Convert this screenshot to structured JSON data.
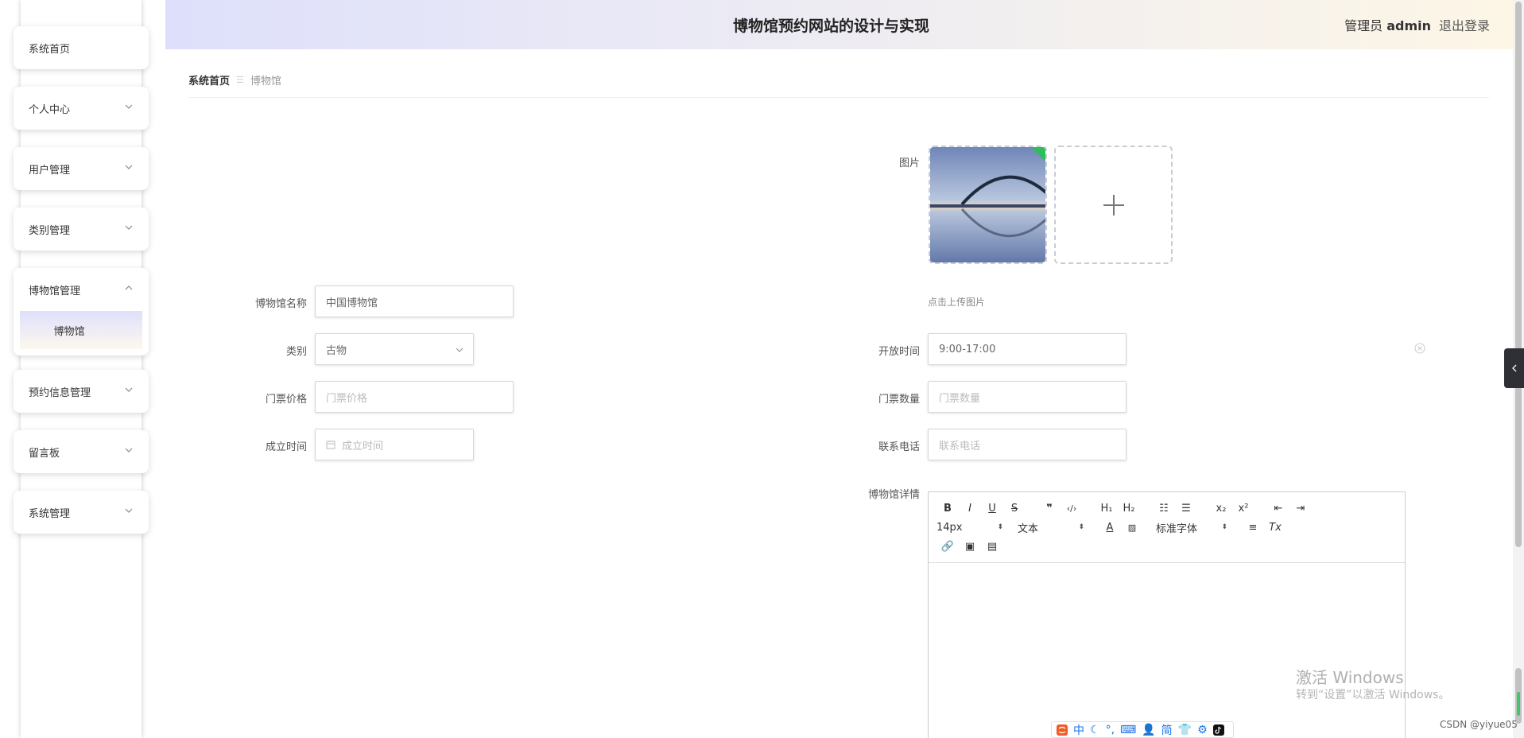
{
  "app": {
    "title": "博物馆预约网站的设计与实现",
    "user_role": "管理员",
    "user_name": "admin",
    "logout": "退出登录"
  },
  "sidebar": {
    "items": [
      {
        "label": "系统首页"
      },
      {
        "label": "个人中心"
      },
      {
        "label": "用户管理"
      },
      {
        "label": "类别管理"
      },
      {
        "label": "博物馆管理",
        "expanded": true,
        "children": [
          {
            "label": "博物馆"
          }
        ]
      },
      {
        "label": "预约信息管理"
      },
      {
        "label": "留言板"
      },
      {
        "label": "系统管理"
      }
    ]
  },
  "breadcrumb": {
    "home": "系统首页",
    "separator": "☰",
    "current": "博物馆"
  },
  "form": {
    "image_label": "图片",
    "upload_hint": "点击上传图片",
    "name_label": "博物馆名称",
    "name_value": "中国博物馆",
    "category_label": "类别",
    "category_value": "古物",
    "open_time_label": "开放时间",
    "open_time_value": "9:00-17:00",
    "price_label": "门票价格",
    "price_placeholder": "门票价格",
    "ticket_count_label": "门票数量",
    "ticket_count_placeholder": "门票数量",
    "founded_label": "成立时间",
    "founded_placeholder": "成立时间",
    "phone_label": "联系电话",
    "phone_placeholder": "联系电话",
    "details_label": "博物馆详情"
  },
  "editor": {
    "font_size": "14px",
    "paragraph": "文本",
    "font_family": "标准字体",
    "h1": "H₁",
    "h2": "H₂",
    "sub": "x₂",
    "sup": "x²"
  },
  "watermark": {
    "line1": "激活 Windows",
    "line2": "转到“设置”以激活 Windows。",
    "csdn": "CSDN @yiyue05"
  },
  "ime": {
    "lang": "中",
    "simplified": "简"
  },
  "colors": {
    "header_left": "#dee0fb",
    "header_right": "#fdf6e6",
    "upload_corner": "#2dbd5a"
  }
}
